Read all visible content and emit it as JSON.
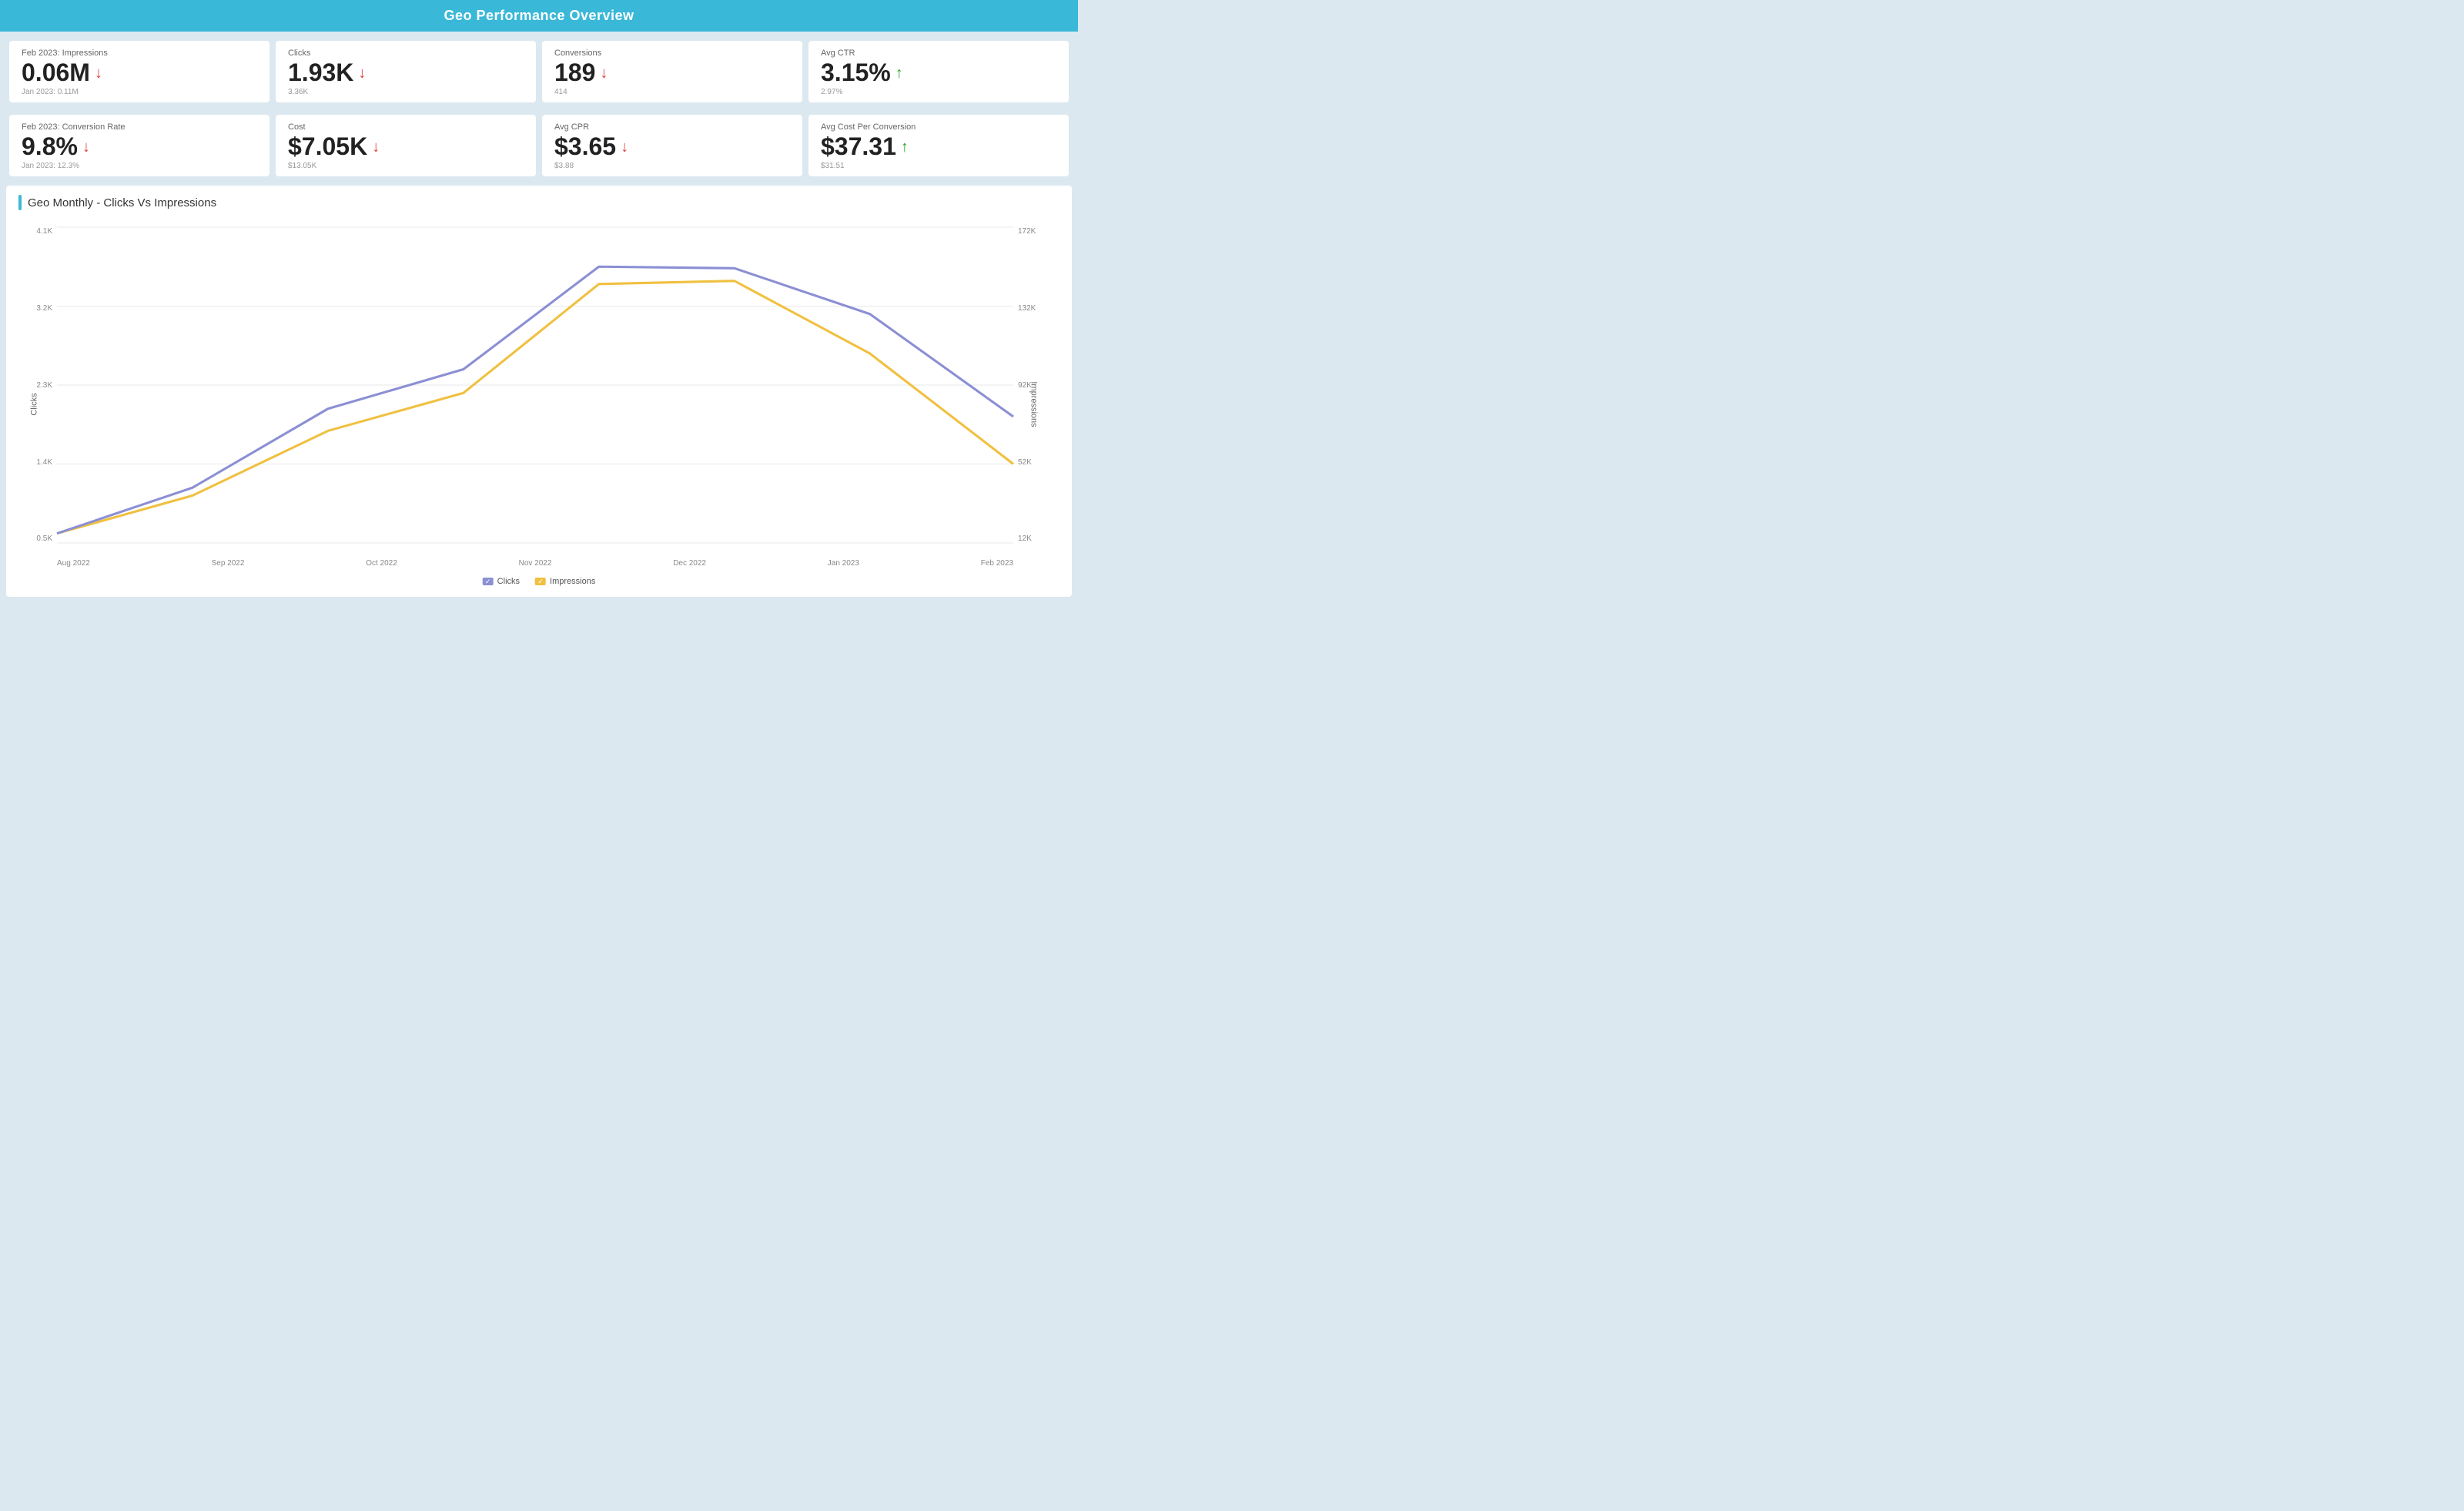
{
  "header": {
    "title": "Geo Performance Overview"
  },
  "metrics_row1": [
    {
      "id": "impressions",
      "label": "Feb 2023: Impressions",
      "value": "0.06M",
      "direction": "down",
      "prev_label": "Jan 2023: 0.11M"
    },
    {
      "id": "clicks",
      "label": "Clicks",
      "value": "1.93K",
      "direction": "down",
      "prev_label": "3.36K"
    },
    {
      "id": "conversions",
      "label": "Conversions",
      "value": "189",
      "direction": "down",
      "prev_label": "414"
    },
    {
      "id": "avg_ctr",
      "label": "Avg CTR",
      "value": "3.15%",
      "direction": "up",
      "prev_label": "2.97%"
    }
  ],
  "metrics_row2": [
    {
      "id": "conversion_rate",
      "label": "Feb 2023: Conversion Rate",
      "value": "9.8%",
      "direction": "down",
      "prev_label": "Jan 2023: 12.3%"
    },
    {
      "id": "cost",
      "label": "Cost",
      "value": "$7.05K",
      "direction": "down",
      "prev_label": "$13.05K"
    },
    {
      "id": "avg_cpr",
      "label": "Avg CPR",
      "value": "$3.65",
      "direction": "down",
      "prev_label": "$3.88"
    },
    {
      "id": "avg_cost_per_conversion",
      "label": "Avg Cost Per Conversion",
      "value": "$37.31",
      "direction": "up",
      "prev_label": "$31.51"
    }
  ],
  "chart": {
    "title": "Geo Monthly - Clicks Vs Impressions",
    "y_left_labels": [
      "4.1K",
      "3.2K",
      "2.3K",
      "1.4K",
      "0.5K"
    ],
    "y_right_labels": [
      "172K",
      "132K",
      "92K",
      "52K",
      "12K"
    ],
    "x_labels": [
      "Aug 2022",
      "Sep 2022",
      "Oct 2022",
      "Nov 2022",
      "Dec 2022",
      "Jan 2023",
      "Feb 2023"
    ],
    "y_axis_left_title": "Clicks",
    "y_axis_right_title": "Impressions",
    "legend": [
      {
        "label": "Clicks",
        "color": "#8b8fd4",
        "type": "check"
      },
      {
        "label": "Impressions",
        "color": "#f0c040",
        "type": "check"
      }
    ]
  }
}
